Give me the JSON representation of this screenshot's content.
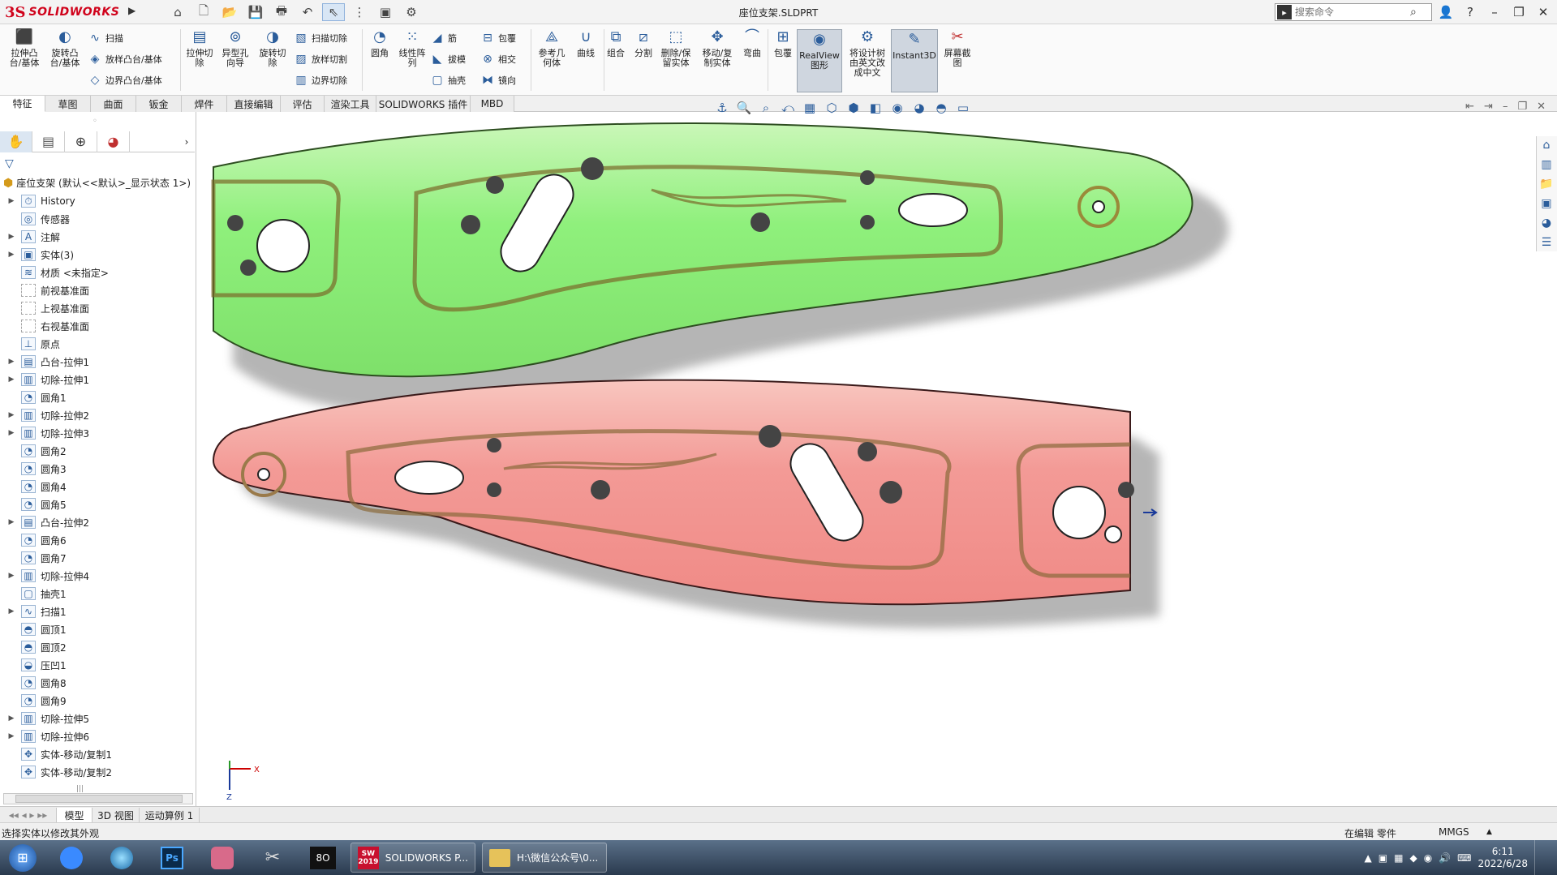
{
  "app": {
    "logo_ds": "3S",
    "logo_text": "SOLIDWORKS",
    "doc_title": "座位支架.SLDPRT",
    "search_placeholder": "搜索命令"
  },
  "ribbon": {
    "extrude_boss": "拉伸凸\n台/基体",
    "revolve_boss": "旋转凸\n台/基体",
    "sweep": "扫描",
    "loft_boss": "放样凸台/基体",
    "boundary_boss": "边界凸台/基体",
    "extrude_cut": "拉伸切\n除",
    "hole_wizard": "异型孔\n向导",
    "revolve_cut": "旋转切\n除",
    "swept_cut": "扫描切除",
    "lofted_cut": "放样切割",
    "boundary_cut": "边界切除",
    "fillet": "圆角",
    "linear_pattern": "线性阵\n列",
    "rib": "筋",
    "draft": "拔模",
    "shell": "抽壳",
    "wrap": "包覆",
    "intersect": "相交",
    "mirror": "镜向",
    "ref_geometry": "参考几\n何体",
    "curves": "曲线",
    "combine": "组合",
    "split": "分割",
    "delete_keep": "删除/保\n留实体",
    "move_copy": "移动/复\n制实体",
    "flex": "弯曲",
    "wrap2": "包覆",
    "realview": "RealView\n图形",
    "translate_tree": "将设计树\n由英文改\n成中文",
    "instant3d": "Instant3D",
    "screenshot": "屏幕截\n图"
  },
  "tabs": [
    "特征",
    "草图",
    "曲面",
    "钣金",
    "焊件",
    "直接编辑",
    "评估",
    "渲染工具",
    "SOLIDWORKS 插件",
    "MBD"
  ],
  "tree": {
    "root": "座位支架  (默认<<默认>_显示状态 1>)",
    "items": [
      {
        "label": "History",
        "icon": "history-icon",
        "exp": true
      },
      {
        "label": "传感器",
        "icon": "sensor-icon",
        "exp": false
      },
      {
        "label": "注解",
        "icon": "annotation-icon",
        "exp": true
      },
      {
        "label": "实体(3)",
        "icon": "solid-bodies-icon",
        "exp": true
      },
      {
        "label": "材质 <未指定>",
        "icon": "material-icon",
        "exp": false
      },
      {
        "label": "前视基准面",
        "icon": "plane-icon",
        "exp": false
      },
      {
        "label": "上视基准面",
        "icon": "plane-icon",
        "exp": false
      },
      {
        "label": "右视基准面",
        "icon": "plane-icon",
        "exp": false
      },
      {
        "label": "原点",
        "icon": "origin-icon",
        "exp": false
      },
      {
        "label": "凸台-拉伸1",
        "icon": "extrude-icon",
        "exp": true
      },
      {
        "label": "切除-拉伸1",
        "icon": "cut-icon",
        "exp": true
      },
      {
        "label": "圆角1",
        "icon": "fillet-icon",
        "exp": false
      },
      {
        "label": "切除-拉伸2",
        "icon": "cut-icon",
        "exp": true
      },
      {
        "label": "切除-拉伸3",
        "icon": "cut-icon",
        "exp": true
      },
      {
        "label": "圆角2",
        "icon": "fillet-icon",
        "exp": false
      },
      {
        "label": "圆角3",
        "icon": "fillet-icon",
        "exp": false
      },
      {
        "label": "圆角4",
        "icon": "fillet-icon",
        "exp": false
      },
      {
        "label": "圆角5",
        "icon": "fillet-icon",
        "exp": false
      },
      {
        "label": "凸台-拉伸2",
        "icon": "extrude-icon",
        "exp": true
      },
      {
        "label": "圆角6",
        "icon": "fillet-icon",
        "exp": false
      },
      {
        "label": "圆角7",
        "icon": "fillet-icon",
        "exp": false
      },
      {
        "label": "切除-拉伸4",
        "icon": "cut-icon",
        "exp": true
      },
      {
        "label": "抽壳1",
        "icon": "shell-icon",
        "exp": false
      },
      {
        "label": "扫描1",
        "icon": "sweep-icon",
        "exp": true
      },
      {
        "label": "圆顶1",
        "icon": "dome-icon",
        "exp": false
      },
      {
        "label": "圆顶2",
        "icon": "dome-icon",
        "exp": false
      },
      {
        "label": "压凹1",
        "icon": "indent-icon",
        "exp": false
      },
      {
        "label": "圆角8",
        "icon": "fillet-icon",
        "exp": false
      },
      {
        "label": "圆角9",
        "icon": "fillet-icon",
        "exp": false
      },
      {
        "label": "切除-拉伸5",
        "icon": "cut-icon",
        "exp": true
      },
      {
        "label": "切除-拉伸6",
        "icon": "cut-icon",
        "exp": true
      },
      {
        "label": "实体-移动/复制1",
        "icon": "move-icon",
        "exp": false
      },
      {
        "label": "实体-移动/复制2",
        "icon": "move-icon",
        "exp": false
      }
    ]
  },
  "triad": {
    "x": "X",
    "z": "Z"
  },
  "bottom_tabs": [
    "模型",
    "3D 视图",
    "运动算例 1"
  ],
  "status": {
    "message": "选择实体以修改其外观",
    "mode": "在编辑 零件",
    "units": "MMGS",
    "units_arrow": "▲"
  },
  "taskbar": {
    "sw_label": "SOLIDWORKS P...",
    "sw_year": "2019",
    "folder_label": "H:\\微信公众号\\0...",
    "time": "6:11",
    "date": "2022/6/28"
  },
  "colors": {
    "green_part": "#8ff07c",
    "red_part": "#f39a96",
    "accent": "#d0021b"
  }
}
